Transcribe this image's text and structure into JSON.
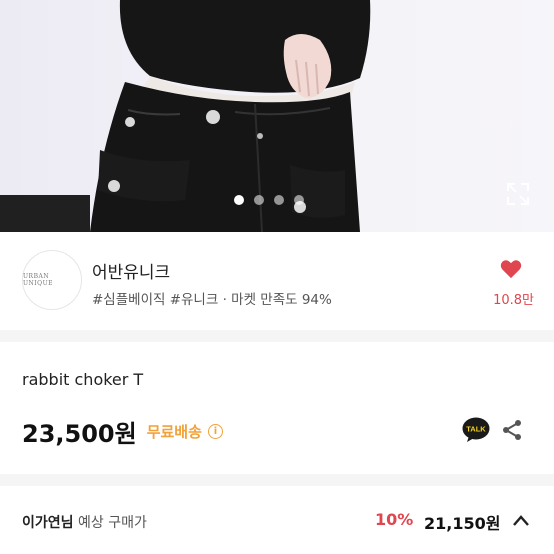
{
  "hero": {
    "image_alt": "",
    "slide_count": 4,
    "active_slide": 1
  },
  "shop": {
    "logo_text": "URBAN UNIQUE",
    "name": "어반유니크",
    "tags": "#심플베이직 #유니크 · 마켓 만족도 94%",
    "likes": "10.8만"
  },
  "product": {
    "title": "rabbit choker T",
    "price": "23,500원",
    "shipping": "무료배송",
    "info_symbol": "i",
    "talk_label": "TALK"
  },
  "purchase": {
    "buyer_name": "이가연님",
    "buyer_label": "예상 구매가",
    "discount": "10%",
    "final_price": "21,150원"
  },
  "colors": {
    "accent_red": "#e0464f",
    "shipping_orange": "#f2a23a",
    "kakao_yellow": "#f7d31a"
  }
}
